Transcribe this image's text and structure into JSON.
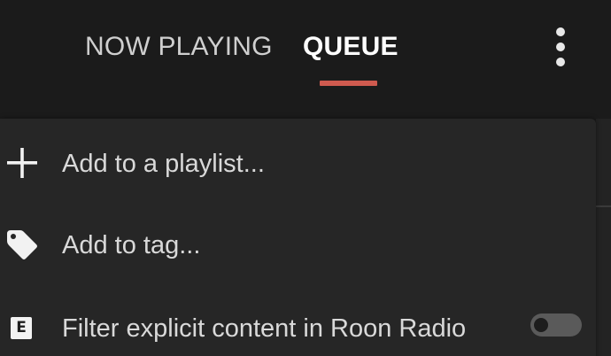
{
  "tabs": {
    "now_playing": "NOW PLAYING",
    "queue": "QUEUE",
    "active": "queue",
    "active_color": "#cf5a4f"
  },
  "header": {
    "more_icon": "vertical-ellipsis-icon"
  },
  "menu": {
    "items": [
      {
        "label": "Add to a playlist...",
        "icon": "plus-icon"
      },
      {
        "label": "Add to tag...",
        "icon": "tag-icon"
      },
      {
        "label": "Filter explicit content in Roon Radio",
        "icon": "explicit-badge-icon",
        "badge_text": "E",
        "toggle_on": false
      }
    ]
  }
}
